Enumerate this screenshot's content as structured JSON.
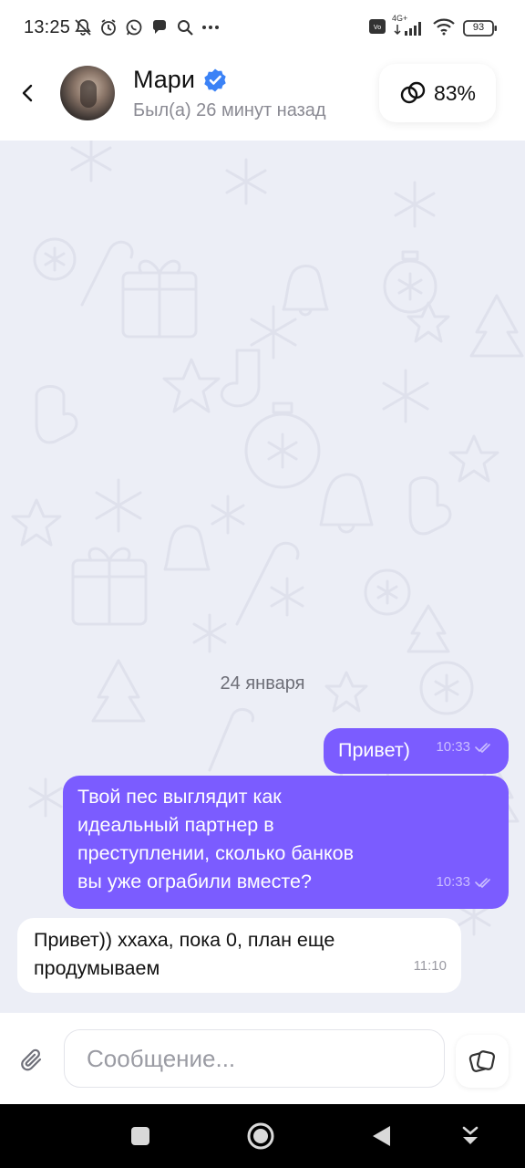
{
  "status_bar": {
    "time": "13:25",
    "battery": "93",
    "network": "4G+"
  },
  "header": {
    "back_icon": "chevron-left-icon",
    "contact_name": "Мари",
    "verified_icon": "verified-badge-icon",
    "last_seen": "Был(а) 26 минут назад",
    "compatibility": "83%"
  },
  "chat": {
    "date_separator": "24 января",
    "messages": [
      {
        "direction": "outgoing",
        "text": "Привет)",
        "time": "10:33",
        "status": "read"
      },
      {
        "direction": "outgoing",
        "text": "Твой пес выглядит как идеальный партнер в преступлении, сколько банков вы уже ограбили вместе?",
        "text_lines": [
          "Твой пес выглядит как",
          "идеальный партнер в",
          "преступлении, сколько банков",
          "вы уже ограбили вместе?"
        ],
        "time": "10:33",
        "status": "read"
      },
      {
        "direction": "incoming",
        "text": "Привет)) ххаха, пока 0, план еще продумываем",
        "text_lines": [
          "Привет)) ххаха, пока 0, план еще",
          "продумываем"
        ],
        "time": "11:10"
      }
    ]
  },
  "composer": {
    "placeholder": "Сообщение..."
  },
  "colors": {
    "accent": "#7b5cff",
    "chat_background": "#eceef6",
    "verified": "#3b82f6"
  }
}
